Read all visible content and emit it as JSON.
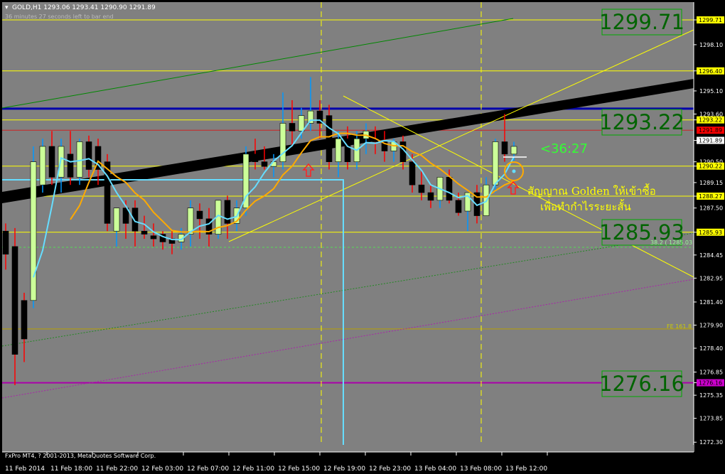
{
  "header": {
    "symbol_info": "GOLD,H1  1293.06 1293.41 1290.90 1291.89",
    "countdown": "36 minutes 27 seconds left to bar end"
  },
  "footer": {
    "copyright": "FxPro MT4, ? 2001-2013, MetaQuotes Software Corp."
  },
  "colors": {
    "chart_bg": "#808080",
    "frame_bg": "#000000",
    "bull_candle": "#ccff99",
    "bear_candle": "#000000",
    "bull_wick": "#0099ff",
    "bear_wick": "#ff0000",
    "axis_text": "#ffffff",
    "big_label_bg": "#808080",
    "big_label_text": "#006400",
    "yellow": "#ffff00",
    "blue_line": "#0000aa",
    "cyan": "#66ddff",
    "orange": "#ffaa00",
    "countdown_green": "#33ff33"
  },
  "chart_data": {
    "type": "candlestick",
    "symbol": "GOLD",
    "timeframe": "H1",
    "ylim": [
      1271.5,
      1301.0
    ],
    "yticks": [
      "1299.71",
      "1298.10",
      "1296.40",
      "1295.10",
      "1293.60",
      "1293.22",
      "1291.89",
      "1290.50",
      "1290.22",
      "1289.15",
      "1288.27",
      "1287.50",
      "1285.93",
      "1284.45",
      "1282.95",
      "1281.40",
      "1279.90",
      "1278.40",
      "1276.85",
      "1276.16",
      "1275.35",
      "1273.85",
      "1272.30"
    ],
    "yaxis_badges": [
      {
        "label": "1299.71",
        "value": 1299.71,
        "bg": "#ffff00",
        "fg": "#000000"
      },
      {
        "label": "1296.40",
        "value": 1296.4,
        "bg": "#ffff00",
        "fg": "#000000"
      },
      {
        "label": "1293.22",
        "value": 1293.22,
        "bg": "#ffff00",
        "fg": "#000000"
      },
      {
        "label": "1291.89",
        "value": 1292.55,
        "bg": "#ff0000",
        "fg": "#000000"
      },
      {
        "label": "1291.89",
        "value": 1291.89,
        "bg": "#ffffff",
        "fg": "#000000"
      },
      {
        "label": "1290.22",
        "value": 1290.22,
        "bg": "#ffff00",
        "fg": "#000000"
      },
      {
        "label": "1288.27",
        "value": 1288.27,
        "bg": "#ffff00",
        "fg": "#000000"
      },
      {
        "label": "1285.93",
        "value": 1285.93,
        "bg": "#ffff00",
        "fg": "#000000"
      },
      {
        "label": "1276.16",
        "value": 1276.16,
        "bg": "#cc00cc",
        "fg": "#000000"
      }
    ],
    "xticks": [
      "11 Feb 2014",
      "11 Feb 18:00",
      "11 Feb 22:00",
      "12 Feb 03:00",
      "12 Feb 07:00",
      "12 Feb 11:00",
      "12 Feb 15:00",
      "12 Feb 19:00",
      "12 Feb 23:00",
      "13 Feb 04:00",
      "13 Feb 08:00",
      "13 Feb 12:00"
    ],
    "big_levels": [
      "1299.71",
      "1293.22",
      "1285.93",
      "1276.16"
    ],
    "candles": [
      [
        1286.0,
        1286.5,
        1283.5,
        1284.5
      ],
      [
        1285.0,
        1286.2,
        1276.0,
        1278.0
      ],
      [
        1281.5,
        1282.0,
        1277.5,
        1279.0
      ],
      [
        1281.5,
        1291.5,
        1281.0,
        1290.5
      ],
      [
        1289.0,
        1292.0,
        1288.5,
        1291.5
      ],
      [
        1291.5,
        1292.5,
        1289.0,
        1289.5
      ],
      [
        1289.5,
        1292.0,
        1288.5,
        1291.5
      ],
      [
        1291.0,
        1292.5,
        1289.0,
        1289.5
      ],
      [
        1289.5,
        1292.0,
        1289.0,
        1291.8
      ],
      [
        1291.8,
        1292.2,
        1289.5,
        1290.0
      ],
      [
        1291.5,
        1292.0,
        1289.0,
        1290.0
      ],
      [
        1290.5,
        1291.0,
        1286.0,
        1286.5
      ],
      [
        1286.0,
        1287.0,
        1285.0,
        1287.5
      ],
      [
        1287.5,
        1288.0,
        1285.5,
        1286.5
      ],
      [
        1287.5,
        1288.0,
        1285.0,
        1286.0
      ],
      [
        1286.0,
        1287.0,
        1285.5,
        1285.8
      ],
      [
        1285.7,
        1286.5,
        1285.0,
        1285.5
      ],
      [
        1285.8,
        1286.0,
        1284.8,
        1285.3
      ],
      [
        1285.5,
        1286.0,
        1284.5,
        1285.2
      ],
      [
        1285.3,
        1286.2,
        1284.8,
        1285.8
      ],
      [
        1285.8,
        1288.0,
        1285.0,
        1287.5
      ],
      [
        1287.3,
        1287.8,
        1285.5,
        1286.8
      ],
      [
        1286.8,
        1287.5,
        1285.0,
        1285.8
      ],
      [
        1285.8,
        1288.0,
        1285.5,
        1288.0
      ],
      [
        1288.0,
        1288.3,
        1285.5,
        1286.5
      ],
      [
        1286.5,
        1288.0,
        1286.0,
        1287.5
      ],
      [
        1287.5,
        1291.5,
        1287.0,
        1291.0
      ],
      [
        1291.0,
        1292.0,
        1290.0,
        1290.5
      ],
      [
        1290.5,
        1291.5,
        1290.0,
        1290.2
      ],
      [
        1290.2,
        1291.0,
        1289.5,
        1290.5
      ],
      [
        1290.5,
        1295.0,
        1290.0,
        1293.0
      ],
      [
        1293.0,
        1294.5,
        1291.5,
        1292.5
      ],
      [
        1292.5,
        1294.0,
        1292.0,
        1293.5
      ],
      [
        1293.0,
        1296.0,
        1292.5,
        1293.8
      ],
      [
        1293.8,
        1294.5,
        1292.0,
        1293.0
      ],
      [
        1293.5,
        1294.2,
        1290.0,
        1290.5
      ],
      [
        1290.5,
        1292.5,
        1289.5,
        1292.0
      ],
      [
        1292.0,
        1292.8,
        1290.0,
        1290.5
      ],
      [
        1290.5,
        1292.5,
        1290.0,
        1292.0
      ],
      [
        1292.0,
        1293.0,
        1291.0,
        1292.5
      ],
      [
        1292.0,
        1292.8,
        1291.0,
        1291.8
      ],
      [
        1291.8,
        1292.5,
        1290.5,
        1291.2
      ],
      [
        1291.2,
        1292.0,
        1290.5,
        1291.8
      ],
      [
        1291.8,
        1292.2,
        1290.0,
        1290.5
      ],
      [
        1290.5,
        1291.0,
        1288.5,
        1289.0
      ],
      [
        1289.0,
        1290.0,
        1288.0,
        1288.5
      ],
      [
        1288.5,
        1289.0,
        1287.5,
        1288.0
      ],
      [
        1288.0,
        1289.5,
        1287.5,
        1289.5
      ],
      [
        1289.5,
        1290.0,
        1287.8,
        1288.0
      ],
      [
        1288.0,
        1288.5,
        1287.0,
        1287.2
      ],
      [
        1287.3,
        1288.0,
        1286.0,
        1288.5
      ],
      [
        1288.5,
        1289.0,
        1286.5,
        1287.0
      ],
      [
        1287.0,
        1289.5,
        1287.0,
        1289.0
      ],
      [
        1289.0,
        1292.0,
        1288.5,
        1291.8
      ],
      [
        1291.8,
        1293.6,
        1290.5,
        1291.0
      ],
      [
        1291.0,
        1291.8,
        1290.5,
        1291.5
      ]
    ]
  },
  "annotations": {
    "countdown_label": "<36:27",
    "signal_line1": "สัญญาณ Golden ให้เข้าซื้อ",
    "signal_line2": "เพื่อทำกำไรระยะสั้น",
    "fibo_label": "38.2 ( 1285.03",
    "fe_label": "FE 161.8"
  }
}
